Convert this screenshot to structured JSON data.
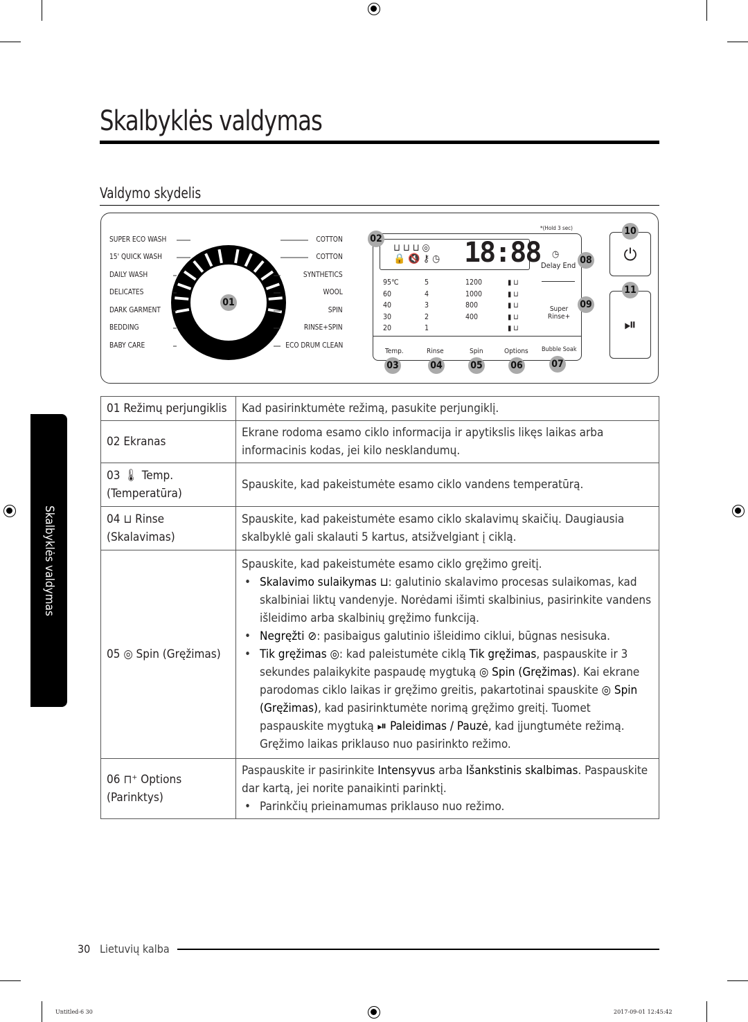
{
  "title": "Skalbyklės valdymas",
  "section": "Valdymo skydelis",
  "panel": {
    "programs_left": [
      "SUPER ECO WASH",
      "15' QUICK WASH",
      "DAILY WASH",
      "DELICATES",
      "DARK GARMENT",
      "BEDDING",
      "BABY CARE"
    ],
    "programs_right": [
      "COTTON",
      "COTTON",
      "SYNTHETICS",
      "WOOL",
      "SPIN",
      "RINSE+SPIN",
      "ECO DRUM CLEAN"
    ],
    "callouts": [
      "01",
      "02",
      "03",
      "04",
      "05",
      "06",
      "07",
      "08",
      "09",
      "10",
      "11"
    ],
    "hold_note": "*(Hold 3 sec)",
    "display_digits": "18:88",
    "delay_end": "Delay End",
    "super_rinse": "Super Rinse+",
    "temps": [
      "95℃",
      "60",
      "40",
      "30",
      "20"
    ],
    "rinses": [
      "5",
      "4",
      "3",
      "2",
      "1"
    ],
    "spins": [
      "1200",
      "1000",
      "800",
      "400"
    ],
    "buttons": [
      "Temp.",
      "Rinse",
      "Spin",
      "Options",
      "Bubble Soak"
    ]
  },
  "table": [
    {
      "key": [
        [
          "01 Režimų perjungiklis"
        ]
      ],
      "val": [
        [
          [
            "Kad pasirinktumėte režimą, pasukite perjungiklį."
          ]
        ]
      ]
    },
    {
      "key": [
        [
          "02 Ekranas"
        ]
      ],
      "val": [
        [
          [
            "Ekrane rodoma esamo ciklo informacija ir apytikslis likęs laikas arba informacinis kodas, jei kilo nesklandumų."
          ]
        ]
      ]
    },
    {
      "key": [
        [
          "03 🌡 Temp."
        ],
        [
          "(Temperatūra)"
        ]
      ],
      "val": [
        [
          [
            "Spauskite, kad pakeistumėte esamo ciklo vandens temperatūrą."
          ]
        ]
      ]
    },
    {
      "key": [
        [
          "04 ⊔ Rinse"
        ],
        [
          "(Skalavimas)"
        ]
      ],
      "val": [
        [
          [
            "Spauskite, kad pakeistumėte esamo ciklo skalavimų skaičių. Daugiausia skalbyklė gali skalauti 5 kartus, atsižvelgiant į ciklą."
          ]
        ]
      ]
    },
    {
      "key": [
        [
          "05 ◎ Spin (Gręžimas)"
        ]
      ],
      "val": [
        [
          [
            "Spauskite, kad pakeistumėte esamo ciklo gręžimo greitį."
          ]
        ],
        [
          [
            "Skalavimo sulaikymas ⊔",
            1
          ],
          [
            ": galutinio skalavimo procesas sulaikomas, kad skalbiniai liktų vandenyje. Norėdami išimti skalbinius, pasirinkite vandens išleidimo arba skalbinių gręžimo funkciją."
          ]
        ],
        [
          [
            "Negręžti ⊘",
            1
          ],
          [
            ": pasibaigus galutinio išleidimo ciklui, būgnas nesisuka."
          ]
        ],
        [
          [
            "Tik gręžimas ◎",
            1
          ],
          [
            ": kad paleistumėte ciklą "
          ],
          [
            "Tik gręžimas",
            1
          ],
          [
            ", paspauskite ir 3 sekundes palaikykite paspaudę mygtuką "
          ],
          [
            "◎ Spin (Gręžimas)",
            1
          ],
          [
            ". Kai ekrane parodomas ciklo laikas ir gręžimo greitis, pakartotinai spauskite "
          ],
          [
            "◎ Spin (Gręžimas)",
            1
          ],
          [
            ", kad pasirinktumėte norimą gręžimo greitį. Tuomet paspauskite mygtuką "
          ],
          [
            "⏯ Paleidimas / Pauzė",
            1
          ],
          [
            ", kad įjungtumėte režimą. Gręžimo laikas priklauso nuo pasirinkto režimo."
          ]
        ]
      ]
    },
    {
      "key": [
        [
          "06 ⊓⁺ Options"
        ],
        [
          "(Parinktys)"
        ]
      ],
      "val": [
        [
          [
            "Paspauskite ir pasirinkite "
          ],
          [
            "Intensyvus",
            1
          ],
          [
            " arba "
          ],
          [
            "Išankstinis skalbimas",
            1
          ],
          [
            ". Paspauskite dar kartą, jei norite panaikinti parinktį."
          ]
        ],
        [
          [
            "Parinkčių prieinamumas priklauso nuo režimo."
          ]
        ]
      ]
    }
  ],
  "side_tab": "Skalbyklės valdymas",
  "footer": {
    "page": "30",
    "language": "Lietuvių kalba"
  },
  "print": {
    "left": "Untitled-6   30",
    "right": "2017-09-01   12:45:42"
  }
}
